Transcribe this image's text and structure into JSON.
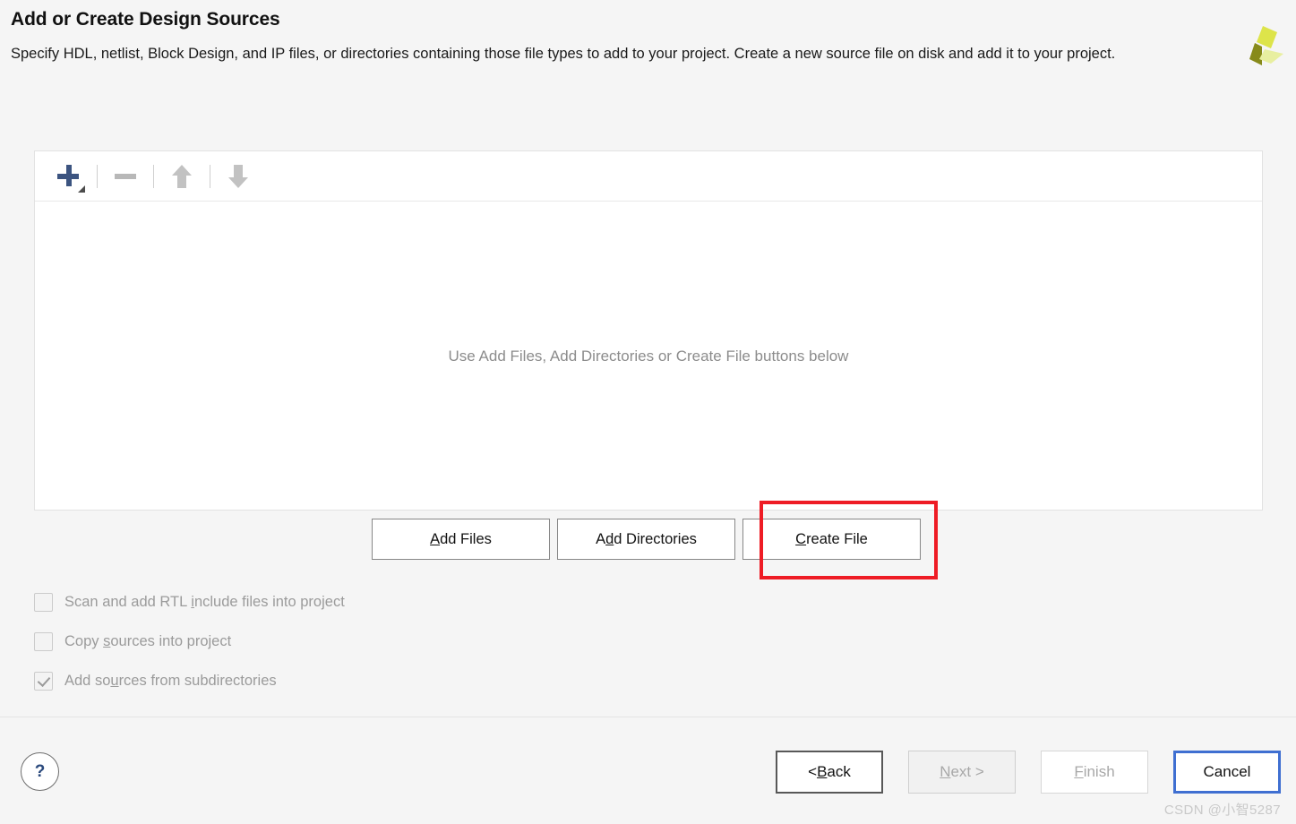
{
  "header": {
    "title": "Add or Create Design Sources",
    "description": "Specify HDL, netlist, Block Design, and IP files, or directories containing those file types to add to your project. Create a new source file on disk and add it to your project.",
    "logo_name": "xilinx-logo",
    "logo_colors": {
      "dark_olive": "#878a1a",
      "bright_yellow_green": "#dde44a",
      "pale_yellow_green": "#e8efa0"
    }
  },
  "sources_panel": {
    "toolbar": [
      {
        "name": "add-sources-button",
        "icon": "plus-icon",
        "color": "#3c5480",
        "has_dropdown": true,
        "enabled": true
      },
      {
        "name": "remove-sources-button",
        "icon": "minus-icon",
        "color": "#b8b8b8",
        "has_dropdown": false,
        "enabled": false
      },
      {
        "name": "move-up-button",
        "icon": "arrow-up-icon",
        "color": "#c2c2c2",
        "has_dropdown": false,
        "enabled": false
      },
      {
        "name": "move-down-button",
        "icon": "arrow-down-icon",
        "color": "#c2c2c2",
        "has_dropdown": false,
        "enabled": false
      }
    ],
    "empty_message": "Use Add Files, Add Directories or Create File buttons below"
  },
  "action_buttons": [
    {
      "name": "add-files-button",
      "mnemonic": "A",
      "rest": "dd Files",
      "enabled": true
    },
    {
      "name": "add-directories-button",
      "prefix": "A",
      "mnemonic": "d",
      "rest": "d Directories",
      "enabled": true
    },
    {
      "name": "create-file-button",
      "mnemonic": "C",
      "rest": "reate File",
      "enabled": true,
      "highlighted": true,
      "highlight_color": "#ee1c25"
    }
  ],
  "options": [
    {
      "name": "scan-rtl-include-checkbox",
      "prefix": "Scan and add RTL ",
      "mnemonic": "i",
      "rest": "nclude files into project",
      "checked": false,
      "enabled": false
    },
    {
      "name": "copy-sources-checkbox",
      "prefix": "Copy ",
      "mnemonic": "s",
      "rest": "ources into project",
      "checked": false,
      "enabled": false
    },
    {
      "name": "add-subdirectories-checkbox",
      "prefix": "Add so",
      "mnemonic": "u",
      "rest": "rces from subdirectories",
      "checked": true,
      "enabled": false
    }
  ],
  "footer": {
    "help_label": "?",
    "back": {
      "prefix": "< ",
      "mnemonic": "B",
      "rest": "ack",
      "enabled": true
    },
    "next": {
      "mnemonic": "N",
      "rest": "ext >",
      "enabled": false
    },
    "finish": {
      "mnemonic": "F",
      "rest": "inish",
      "enabled": false
    },
    "cancel": {
      "label": "Cancel",
      "enabled": true,
      "focused": true,
      "focus_color": "#3f6fd1"
    }
  },
  "watermark": "CSDN @小智5287"
}
